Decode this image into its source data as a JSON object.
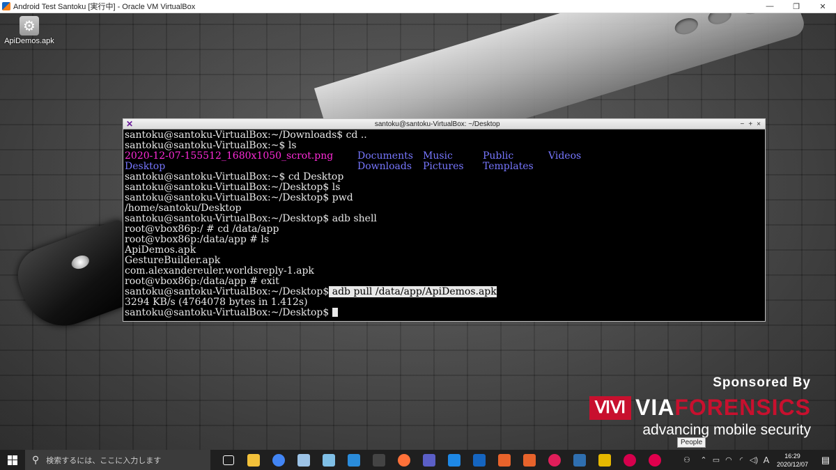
{
  "host_window": {
    "title": "Android Test Santoku [実行中] - Oracle VM VirtualBox",
    "controls": [
      "—",
      "❐",
      "✕"
    ]
  },
  "desktop": {
    "icons": [
      {
        "label": "ApiDemos.apk",
        "icon": "gear-icon"
      }
    ]
  },
  "terminal": {
    "title": "santoku@santoku-VirtualBox: ~/Desktop",
    "controls": [
      "−",
      "+",
      "×"
    ],
    "lines": {
      "l1": "santoku@santoku-VirtualBox:~/Downloads$ cd ..",
      "l2": "santoku@santoku-VirtualBox:~$ ls",
      "ls_row1": {
        "c1": "2020-12-07-155512_1680x1050_scrot.png",
        "c2": "Documents",
        "c3": "Music",
        "c4": "Public",
        "c5": "Videos"
      },
      "ls_row2": {
        "c1": "Desktop",
        "c2": "Downloads",
        "c3": "Pictures",
        "c4": "Templates"
      },
      "l5": "santoku@santoku-VirtualBox:~$ cd Desktop",
      "l6": "santoku@santoku-VirtualBox:~/Desktop$ ls",
      "l7": "santoku@santoku-VirtualBox:~/Desktop$ pwd",
      "l8": "/home/santoku/Desktop",
      "l9": "santoku@santoku-VirtualBox:~/Desktop$ adb shell",
      "l10": "root@vbox86p:/ # cd /data/app",
      "l11": "root@vbox86p:/data/app # ls",
      "l12": "ApiDemos.apk",
      "l13": "GestureBuilder.apk",
      "l14": "com.alexandereuler.worldsreply-1.apk",
      "l15": "root@vbox86p:/data/app # exit",
      "l16_prompt": "santoku@santoku-VirtualBox:~/Desktop$",
      "l16_cmd": " adb pull /data/app/ApiDemos.apk",
      "l17": "3294 KB/s (4764078 bytes in 1.412s)",
      "l18_prompt": "santoku@santoku-VirtualBox:~/Desktop$ "
    }
  },
  "sponsor": {
    "line1": "Sponsored By",
    "brand_via": "VIA",
    "brand_forensics": "FORENSICS",
    "tagline": "advancing mobile security"
  },
  "tooltip": "People",
  "taskbar": {
    "search_placeholder": "検索するには、ここに入力します",
    "ime_indicator": "A",
    "time": "16:29",
    "date": "2020/12/07",
    "apps": [
      {
        "name": "task-view",
        "color": "#ffffff"
      },
      {
        "name": "file-explorer",
        "color": "#f3c13a"
      },
      {
        "name": "chrome",
        "color": "#4285f4"
      },
      {
        "name": "pen-tool",
        "color": "#9cc3e6"
      },
      {
        "name": "notes",
        "color": "#7fbfe6"
      },
      {
        "name": "remote-desktop",
        "color": "#2a8cdb"
      },
      {
        "name": "terminal",
        "color": "#444444"
      },
      {
        "name": "firefox",
        "color": "#ff7139"
      },
      {
        "name": "teams",
        "color": "#5b5fc7"
      },
      {
        "name": "vscode-blue",
        "color": "#1e88e5"
      },
      {
        "name": "edit-tool",
        "color": "#1565c0"
      },
      {
        "name": "burp",
        "color": "#e8632b"
      },
      {
        "name": "burp2",
        "color": "#e8632b"
      },
      {
        "name": "slack",
        "color": "#e01e5a"
      },
      {
        "name": "virtualbox",
        "color": "#2f6fb0"
      },
      {
        "name": "app-yellow",
        "color": "#e6b800"
      },
      {
        "name": "flickr-red",
        "color": "#d6004c"
      },
      {
        "name": "app-circles",
        "color": "#e0004d"
      }
    ]
  }
}
